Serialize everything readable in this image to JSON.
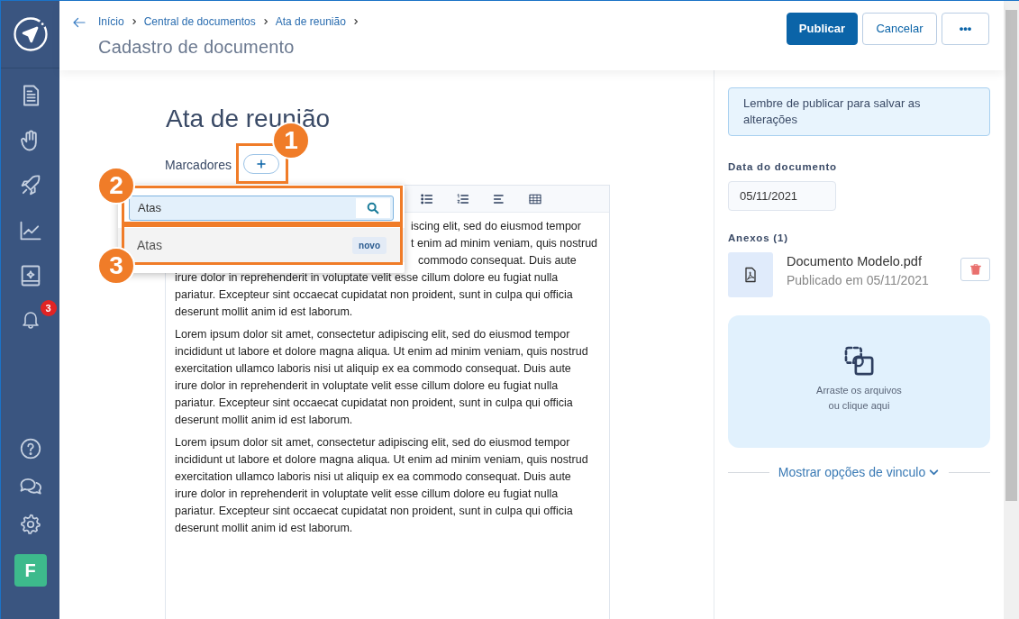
{
  "sidebar": {
    "notification_count": "3",
    "avatar": "F"
  },
  "header": {
    "breadcrumbs": [
      "Início",
      "Central de documentos",
      "Ata de reunião"
    ],
    "title": "Cadastro de documento",
    "buttons": [
      {
        "label": "Publicar",
        "kind": "primary"
      },
      {
        "label": "Cancelar",
        "kind": "secondary"
      },
      {
        "label": "•••",
        "kind": "more"
      }
    ]
  },
  "document": {
    "title": "Ata de reunião",
    "tags_label": "Marcadores"
  },
  "tag_dropdown": {
    "search_value": "Atas",
    "options": [
      {
        "label": "Atas",
        "badge": "novo",
        "selected": true
      }
    ]
  },
  "editor": {
    "hidden_start_lines": [
      "iscing elit, sed do eiusmod tempor",
      "t enim ad minim veniam, quis nostrud",
      "commodo consequat. Duis aute"
    ],
    "first_paragraph_rest": "irure dolor in reprehenderit in voluptate velit esse cillum dolore eu fugiat nulla pariatur. Excepteur sint occaecat cupidatat non proident, sunt in culpa qui officia deserunt mollit anim id est laborum.",
    "paragraphs": [
      "Lorem ipsum dolor sit amet, consectetur adipiscing elit, sed do eiusmod tempor incididunt ut labore et dolore magna aliqua. Ut enim ad minim veniam, quis nostrud exercitation ullamco laboris nisi ut aliquip ex ea commodo consequat. Duis aute irure dolor in reprehenderit in voluptate velit esse cillum dolore eu fugiat nulla pariatur. Excepteur sint occaecat cupidatat non proident, sunt in culpa qui officia deserunt mollit anim id est laborum.",
      "Lorem ipsum dolor sit amet, consectetur adipiscing elit, sed do eiusmod tempor incididunt ut labore et dolore magna aliqua. Ut enim ad minim veniam, quis nostrud exercitation ullamco laboris nisi ut aliquip ex ea commodo consequat. Duis aute irure dolor in reprehenderit in voluptate velit esse cillum dolore eu fugiat nulla pariatur. Excepteur sint occaecat cupidatat non proident, sunt in culpa qui officia deserunt mollit anim id est laborum."
    ]
  },
  "annotations": [
    {
      "number": "1"
    },
    {
      "number": "2"
    },
    {
      "number": "3"
    }
  ],
  "panel": {
    "notice": "Lembre de publicar para salvar as alterações",
    "date_label": "Data do documento",
    "date_value": "05/11/2021",
    "attachments_label": "Anexos (1)",
    "attachments": [
      {
        "name": "Documento Modelo.pdf",
        "meta": "Publicado em 05/11/2021"
      }
    ],
    "dropzone": [
      "Arraste os arquivos",
      "ou clique aqui"
    ],
    "link": "Mostrar opções de vinculo"
  }
}
